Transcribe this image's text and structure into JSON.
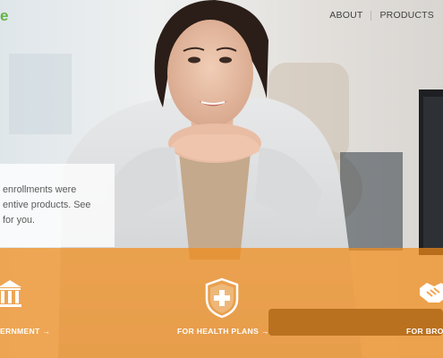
{
  "header": {
    "logo_fragment": "e",
    "nav": [
      {
        "label": "ABOUT"
      },
      {
        "label": "PRODUCTS"
      }
    ]
  },
  "promo": {
    "lines": [
      " enrollments were",
      "entive products. See",
      " for you."
    ]
  },
  "band": {
    "items": [
      {
        "label": "ERNMENT →",
        "icon": "government-building-icon"
      },
      {
        "label": "FOR HEALTH PLANS →",
        "icon": "medical-shield-icon"
      },
      {
        "label": "FOR BRO",
        "icon": "handshake-icon"
      }
    ]
  },
  "colors": {
    "logo_green": "#62b343",
    "band_orange": "#f38c19",
    "nav_text": "#3f3f3f"
  }
}
